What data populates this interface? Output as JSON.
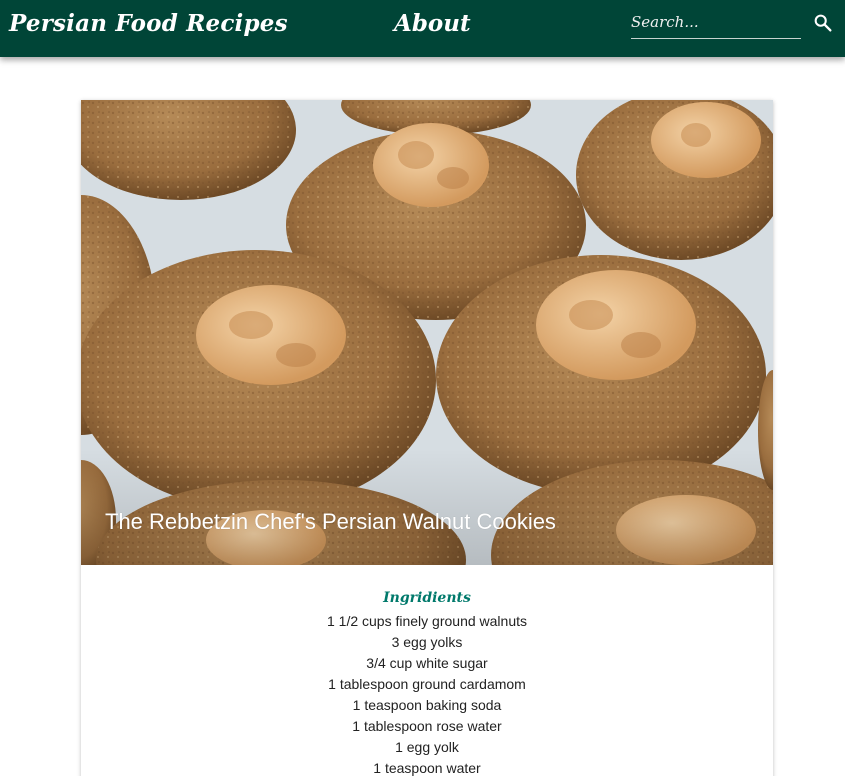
{
  "header": {
    "brand": "Persian Food Recipes",
    "nav_about": "About",
    "search_placeholder": "Search..."
  },
  "icons": {
    "search": "search-icon"
  },
  "colors": {
    "header_bg": "#004537",
    "heading_accent": "#00796b"
  },
  "recipe": {
    "title": "The Rebbetzin Chef's Persian Walnut Cookies",
    "ingredients_heading": "Ingridients",
    "ingredients": [
      "1 1/2 cups finely ground walnuts",
      "3 egg yolks",
      "3/4 cup white sugar",
      "1 tablespoon ground cardamom",
      "1 teaspoon baking soda",
      "1 tablespoon rose water",
      "1 egg yolk",
      "1 teaspoon water"
    ]
  }
}
